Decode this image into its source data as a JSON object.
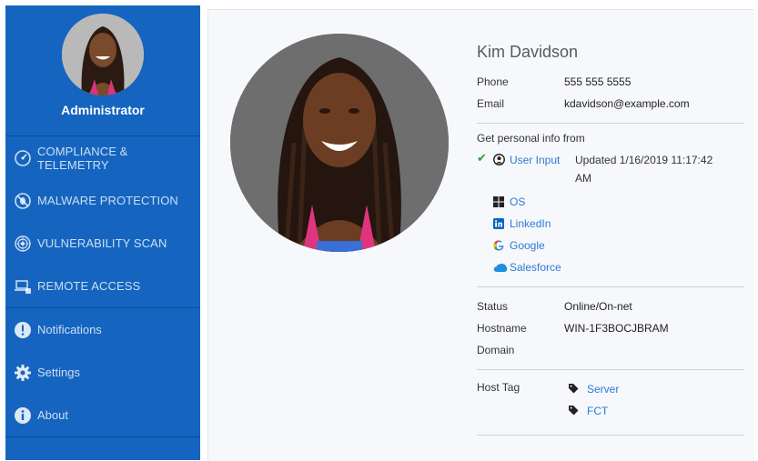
{
  "sidebar": {
    "role": "Administrator",
    "main_nav": [
      {
        "label": "COMPLIANCE & TELEMETRY",
        "icon": "gauge-icon"
      },
      {
        "label": "MALWARE PROTECTION",
        "icon": "no-bug-icon"
      },
      {
        "label": "VULNERABILITY SCAN",
        "icon": "radar-icon"
      },
      {
        "label": "REMOTE ACCESS",
        "icon": "remote-laptop-icon"
      }
    ],
    "secondary_nav": [
      {
        "label": "Notifications",
        "icon": "exclamation-icon"
      },
      {
        "label": "Settings",
        "icon": "gear-icon"
      },
      {
        "label": "About",
        "icon": "info-icon"
      }
    ]
  },
  "profile": {
    "name": "Kim Davidson",
    "phone_label": "Phone",
    "phone": "555 555 5555",
    "email_label": "Email",
    "email": "kdavidson@example.com",
    "sources_title": "Get personal info from",
    "sources": {
      "user_input": "User Input",
      "updated": "Updated 1/16/2019 11:17:42 AM",
      "os": "OS",
      "linkedin": "LinkedIn",
      "google": "Google",
      "salesforce": "Salesforce"
    },
    "status_label": "Status",
    "status": "Online/On-net",
    "hostname_label": "Hostname",
    "hostname": "WIN-1F3BOCJBRAM",
    "domain_label": "Domain",
    "domain": "",
    "host_tag_label": "Host Tag",
    "host_tags": [
      "Server",
      "FCT"
    ]
  },
  "colors": {
    "sidebar": "#1565c0",
    "link": "#2a7bd6",
    "check": "#2e9b3b"
  }
}
